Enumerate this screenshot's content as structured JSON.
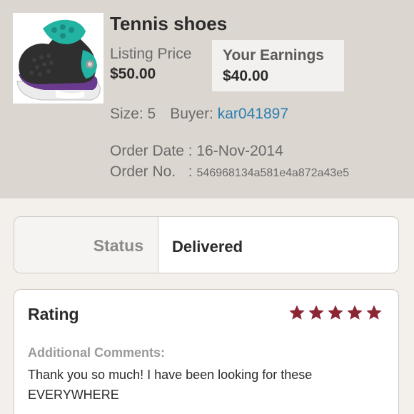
{
  "listing": {
    "title": "Tennis shoes",
    "image_icon": "sneaker-photo",
    "listing_price_label": "Listing Price",
    "listing_price": "$50.00",
    "earnings_label": "Your Earnings",
    "earnings": "$40.00",
    "size_text": "Size: 5",
    "buyer_label": "Buyer:",
    "buyer_username": "kar041897",
    "order_date_text": "Order Date : 16-Nov-2014",
    "order_no_label": "Order No.   :",
    "order_no": "546968134a581e4a872a43e5"
  },
  "status": {
    "label": "Status",
    "value": "Delivered"
  },
  "rating": {
    "title": "Rating",
    "stars": 5,
    "star_icon": "star-icon",
    "star_color": "#8b2635",
    "comments_label": "Additional Comments:",
    "comments_text": "Thank you so much! I have been looking for these EVERYWHERE"
  },
  "colors": {
    "header_bg": "#dcd6d0",
    "page_bg": "#f3efea",
    "link": "#2b7fb0"
  }
}
